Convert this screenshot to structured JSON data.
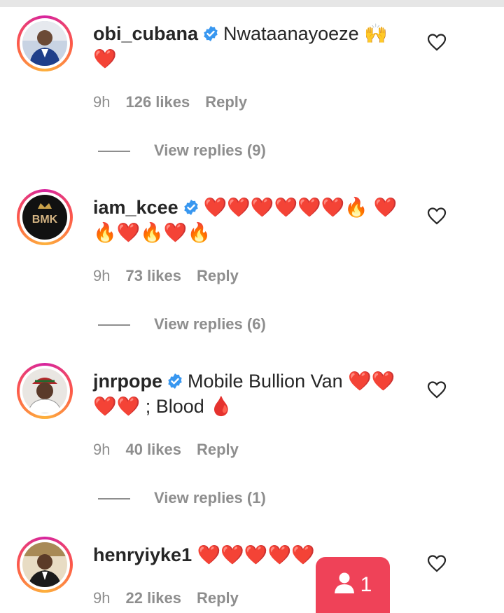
{
  "comments": [
    {
      "username": "obi_cubana",
      "verified": true,
      "text": "Nwataanayoeze 🙌 ❤️",
      "time": "9h",
      "likes": "126 likes",
      "reply": "Reply",
      "view_replies": "View replies (9)"
    },
    {
      "username": "iam_kcee",
      "verified": true,
      "text": "❤️❤️❤️❤️❤️❤️🔥 ❤️🔥❤️🔥❤️🔥",
      "time": "9h",
      "likes": "73 likes",
      "reply": "Reply",
      "view_replies": "View replies (6)",
      "avatar_text": "BMK"
    },
    {
      "username": "jnrpope",
      "verified": true,
      "text": "Mobile Bullion Van ❤️❤️ ❤️❤️ ; Blood 🩸",
      "time": "9h",
      "likes": "40 likes",
      "reply": "Reply",
      "view_replies": "View replies (1)"
    },
    {
      "username": "henryiyke1",
      "verified": false,
      "text": "❤️❤️❤️❤️❤️",
      "time": "9h",
      "likes": "22 likes",
      "reply": "Reply"
    }
  ],
  "fab": {
    "count": "1"
  },
  "colors": {
    "accent": "#ef4258",
    "verified": "#3897f0",
    "muted": "#8e8e8e"
  },
  "icons": {
    "like": "heart-outline-icon",
    "verified": "verified-badge-icon",
    "fab": "person-icon"
  }
}
